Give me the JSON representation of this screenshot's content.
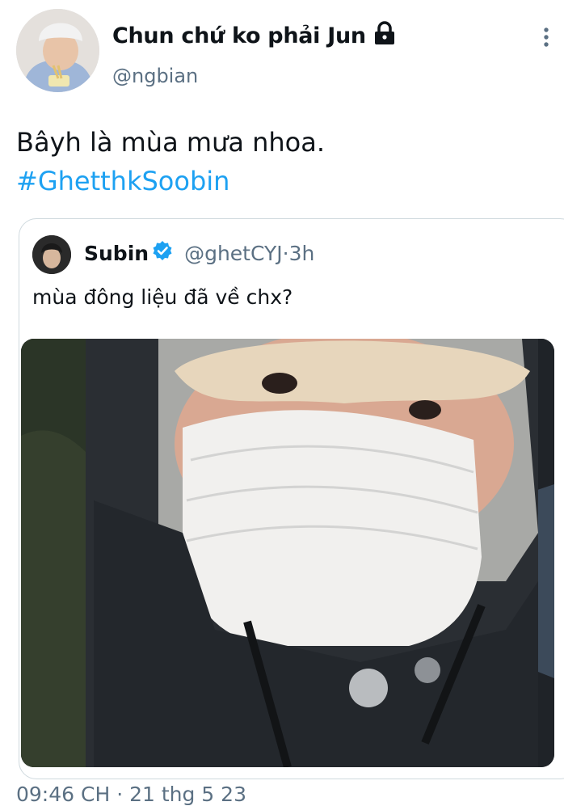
{
  "tweet": {
    "display_name": "Chun chứ ko phải Jun",
    "handle": "@ngbian",
    "text_line1": "Bâyh là mùa mưa nhoa.",
    "hashtag": "#GhetthkSoobin",
    "timestamp": "09:46 CH · 21 thg 5 23"
  },
  "quote": {
    "name": "Subin",
    "handle": "@ghetCYJ",
    "separator": " · ",
    "time": "3h",
    "text": "mùa đông liệu đã về chx?"
  },
  "colors": {
    "accent": "#1da1f2",
    "muted": "#5b7083",
    "border": "#cfd9de"
  },
  "icons": [
    "lock-icon",
    "more-vertical-icon",
    "verified-badge-icon"
  ]
}
